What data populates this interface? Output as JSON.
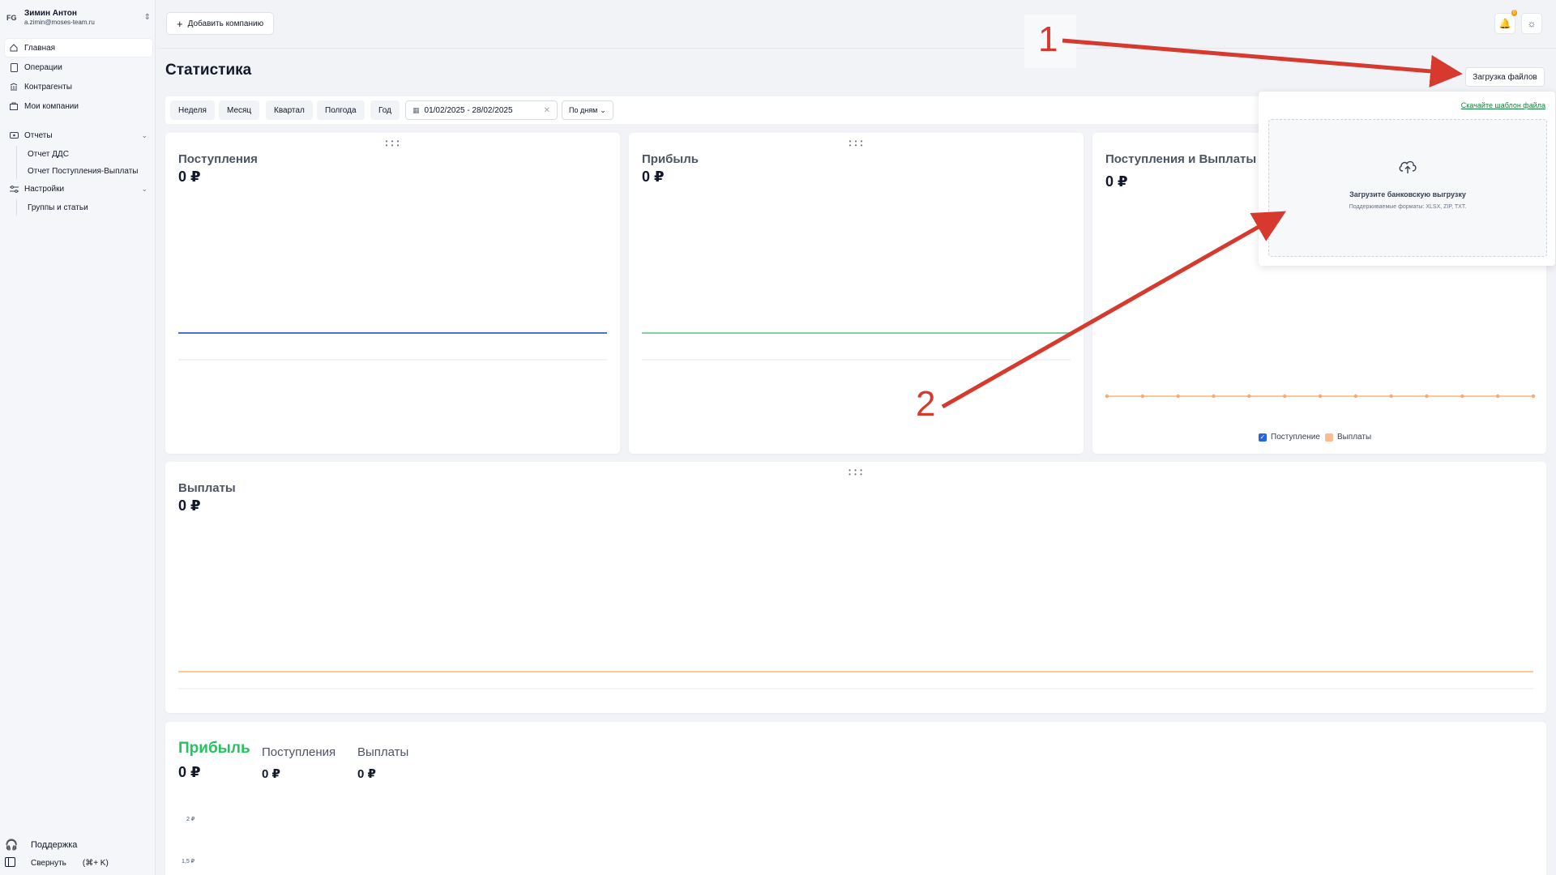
{
  "user": {
    "initials": "FG",
    "name": "Зимин Антон",
    "email": "a.zimin@moses-team.ru"
  },
  "nav": {
    "items": [
      {
        "label": "Главная",
        "icon": "home-icon",
        "active": true
      },
      {
        "label": "Операции",
        "icon": "document-icon"
      },
      {
        "label": "Контрагенты",
        "icon": "bank-icon"
      },
      {
        "label": "Мои компании",
        "icon": "briefcase-icon"
      }
    ],
    "reports": {
      "label": "Отчеты",
      "icon": "reports-icon",
      "items": [
        "Отчет ДДС",
        "Отчет Поступления-Выплаты"
      ]
    },
    "settings": {
      "label": "Настройки",
      "icon": "sliders-icon",
      "items": [
        "Группы и статьи"
      ]
    }
  },
  "bottom": {
    "support": "Поддержка",
    "collapse": "Свернуть",
    "shortcut": "(⌘+ K)"
  },
  "topbar": {
    "add_company": "Добавить компанию",
    "notifications_badge": "0"
  },
  "page": {
    "title": "Статистика",
    "upload_button": "Загрузка файлов"
  },
  "filters": {
    "periods": [
      "Неделя",
      "Месяц",
      "Квартал",
      "Полгода",
      "Год"
    ],
    "date_range": "01/02/2025 - 28/02/2025",
    "grouping": "По дням"
  },
  "cards": {
    "income": {
      "title": "Поступления",
      "value": "0 ₽"
    },
    "profit": {
      "title": "Прибыль",
      "value": "0 ₽"
    },
    "income_payouts": {
      "title": "Поступления и Выплаты",
      "value": "0 ₽",
      "legend": [
        {
          "label": "Поступление",
          "color": "#2563eb"
        },
        {
          "label": "Выплаты",
          "color": "#fdba8c"
        }
      ]
    },
    "payouts": {
      "title": "Выплаты",
      "value": "0 ₽"
    },
    "summary": {
      "profit_title": "Прибыль",
      "profit_value": "0 ₽",
      "income_title": "Поступления",
      "income_value": "0 ₽",
      "payouts_title": "Выплаты",
      "payouts_value": "0 ₽",
      "y_ticks": [
        "2 ₽",
        "1,5 ₽"
      ]
    }
  },
  "popup": {
    "template_link": "Скачайте шаблон файла",
    "dropzone_title": "Загрузите банковскую выгрузку",
    "dropzone_formats": "Поддерживаемые форматы: XLSX, ZIP, TXT."
  },
  "annotations": [
    "1",
    "2"
  ],
  "colors": {
    "income_line": "#4f6fd1",
    "profit_line": "#86cfa2",
    "payouts_line": "#fdc79a",
    "profit_title": "#22c55e",
    "accent_red": "#d63a2f",
    "link_green": "#15803d"
  }
}
